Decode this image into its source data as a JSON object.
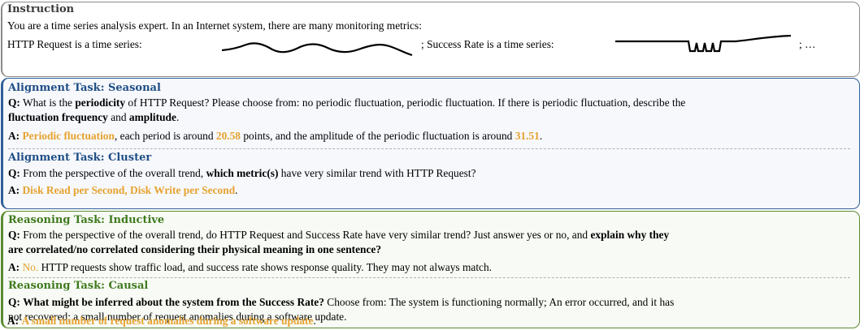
{
  "instruction": {
    "title": "Instruction",
    "line1": "You are a time series analysis expert. In an Internet system, there are many monitoring metrics:",
    "line2a": "HTTP Request is a time series:",
    "line2b": "; Success Rate is a time series:",
    "line2c": "; …"
  },
  "alignment": {
    "seasonal": {
      "title": "Alignment Task: Seasonal",
      "q_prefix": "Q:",
      "q1": "What is the ",
      "q1b": "periodicity",
      "q1c": " of HTTP Request? Please choose from: no periodic fluctuation, periodic fluctuation. If there is periodic fluctuation, describe the",
      "q2a": "fluctuation frequency",
      "q2b": " and ",
      "q2c": "amplitude",
      "q2d": ".",
      "a_prefix": "A:",
      "a1": "Periodic fluctuation",
      "a2": ", each period is around ",
      "a3": "20.58",
      "a4": " points, and the amplitude of the periodic fluctuation is around ",
      "a5": "31.51",
      "a6": "."
    },
    "cluster": {
      "title": "Alignment Task: Cluster",
      "q_prefix": "Q:",
      "q1": "From the perspective of the overall trend, ",
      "q1b": "which metric(s)",
      "q1c": " have very similar trend with HTTP Request?",
      "a_prefix": "A:",
      "a1": "Disk Read per Second, Disk Write per Second",
      "a2": "."
    }
  },
  "reasoning": {
    "inductive": {
      "title": "Reasoning Task: Inductive",
      "q_prefix": "Q:",
      "q1": "From the perspective of the overall trend, do HTTP Request and Success Rate have very similar trend? Just answer yes or no, and ",
      "q1b": "explain why they",
      "q2": "are correlated/no correlated considering their physical meaning in one sentence?",
      "a_prefix": "A:",
      "a1": "No.",
      "a2": " HTTP requests show traffic load, and success rate shows response quality. They may not always match."
    },
    "causal": {
      "title": "Reasoning Task: Causal",
      "q_prefix": "Q:",
      "q1b": "What might be inferred about the system from the Success Rate?",
      "q1c": " Choose from: The system is functioning normally; An error occurred, and it has",
      "q2": "not recovered; a small number of request anomalies during a software update.",
      "a_prefix": "A:",
      "a1": "A small number of request anomalies during a software update",
      "a2": "."
    }
  },
  "colors": {
    "instruction_border": "#8a8a8a",
    "alignment_border": "#2f5e9a",
    "reasoning_border": "#5a8a32",
    "highlight": "#e6a22e"
  }
}
